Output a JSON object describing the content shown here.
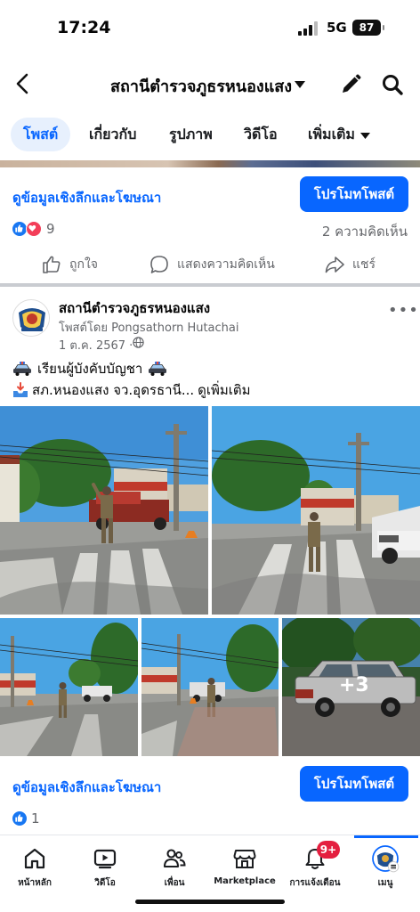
{
  "status_bar": {
    "time": "17:24",
    "network": "5G",
    "battery": "87"
  },
  "header": {
    "title": "สถานีตำรวจภูธรหนองแสง"
  },
  "tabs": [
    "โพสต์",
    "เกี่ยวกับ",
    "รูปภาพ",
    "วิดีโอ",
    "เพิ่มเติม"
  ],
  "previous_post": {
    "insights_label": "ดูข้อมูลเชิงลึกและโฆษณา",
    "promote_label": "โปรโมทโพสต์",
    "reactions_count": "9",
    "comments_count": "2 ความคิดเห็น",
    "actions": {
      "like": "ถูกใจ",
      "comment": "แสดงความคิดเห็น",
      "share": "แชร์"
    }
  },
  "post": {
    "page_name": "สถานีตำรวจภูธรหนองแสง",
    "posted_by": "โพสต์โดย Pongsathorn Hutachai",
    "date": "1 ต.ค. 2567 ·",
    "menu": "•••",
    "line1_text": "เรียนผู้บังคับบัญชา",
    "line2_text": "สภ.หนองแสง จว.อุดรธานี...",
    "see_more": "ดูเพิ่มเติม",
    "more_photos": "+3",
    "insights_label": "ดูข้อมูลเชิงลึกและโฆษณา",
    "promote_label": "โปรโมทโพสต์",
    "reactions_count": "1"
  },
  "bottom_nav": [
    {
      "label": "หน้าหลัก",
      "icon": "home-icon"
    },
    {
      "label": "วิดีโอ",
      "icon": "video-icon"
    },
    {
      "label": "เพื่อน",
      "icon": "friends-icon"
    },
    {
      "label": "Marketplace",
      "icon": "marketplace-icon"
    },
    {
      "label": "การแจ้งเตือน",
      "icon": "bell-icon"
    },
    {
      "label": "เมนู",
      "icon": "menu-avatar-icon"
    }
  ],
  "notification_badge": "9+",
  "colors": {
    "accent": "#0866ff",
    "love": "#f33e58",
    "badge": "#e41e3f"
  }
}
